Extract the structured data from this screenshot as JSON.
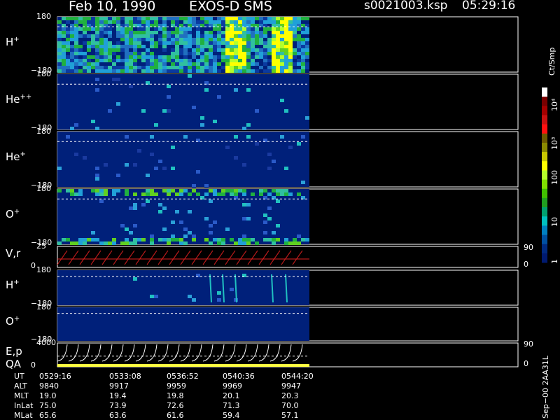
{
  "header": {
    "date": "Feb 10, 1990",
    "instrument": "EXOS-D SMS",
    "file": "s0021003.ksp",
    "time": "05:29:16"
  },
  "panels": [
    {
      "label": "H",
      "sup": "+",
      "top_tick": "180",
      "bottom_tick": "−180",
      "kind": "spectrogram",
      "intensity": "high"
    },
    {
      "label": "He",
      "sup": "++",
      "top_tick": "180",
      "bottom_tick": "−180",
      "kind": "spectrogram",
      "intensity": "low"
    },
    {
      "label": "He",
      "sup": "+",
      "top_tick": "180",
      "bottom_tick": "−180",
      "kind": "spectrogram",
      "intensity": "low"
    },
    {
      "label": "O",
      "sup": "+",
      "top_tick": "180",
      "bottom_tick": "−180",
      "kind": "spectrogram",
      "intensity": "medium"
    },
    {
      "label": "V,r",
      "sup": "",
      "top_tick": "25",
      "bottom_tick": "0",
      "right_top": "90",
      "right_bottom": "0",
      "kind": "sawtooth",
      "color": "#e02020"
    },
    {
      "label": "H",
      "sup": "+",
      "top_tick": "180",
      "bottom_tick": "−180",
      "kind": "spectrogram",
      "intensity": "streaks"
    },
    {
      "label": "O",
      "sup": "+",
      "top_tick": "180",
      "bottom_tick": "−180",
      "kind": "spectrogram",
      "intensity": "empty"
    },
    {
      "label": "E,p",
      "sup": "",
      "label2": "QA",
      "top_tick": "4000",
      "bottom_tick": "0",
      "right_top": "90",
      "right_bottom": "0",
      "kind": "sweep",
      "color": "#ffffff"
    }
  ],
  "colorbar": {
    "unit": "Ct/Smp",
    "ticks": [
      "10⁴",
      "10³",
      "100",
      "10",
      "1"
    ],
    "colors": [
      "#ffffff",
      "#7a0000",
      "#a50000",
      "#c81010",
      "#ff1010",
      "#6b5a00",
      "#8a8a00",
      "#c8c800",
      "#ffff00",
      "#b4ff2a",
      "#7fe000",
      "#40c000",
      "#20a020",
      "#00a070",
      "#00c0c0",
      "#0080c0",
      "#0050a0",
      "#002a80",
      "#001a70"
    ]
  },
  "side_note": "Sep−00 2AA31L",
  "footer": {
    "row_labels": [
      "UT",
      "ALT",
      "MLT",
      "InLat",
      "MLat"
    ],
    "columns": [
      [
        "0529:16",
        "9840",
        "19.0",
        "75.0",
        "65.6"
      ],
      [
        "0533:08",
        "9917",
        "19.4",
        "73.9",
        "63.6"
      ],
      [
        "0536:52",
        "9959",
        "19.8",
        "72.6",
        "61.6"
      ],
      [
        "0540:36",
        "9969",
        "20.1",
        "71.3",
        "59.4"
      ],
      [
        "0544:20",
        "9947",
        "20.3",
        "70.0",
        "57.1"
      ]
    ]
  }
}
